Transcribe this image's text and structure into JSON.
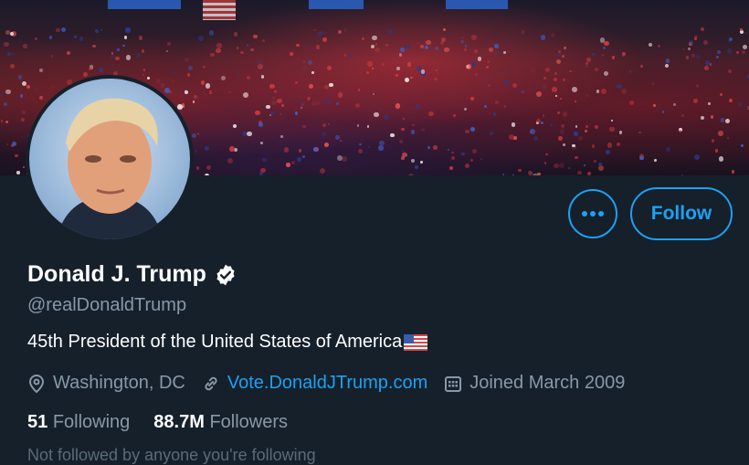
{
  "profile": {
    "display_name": "Donald J. Trump",
    "verified": true,
    "handle": "@realDonaldTrump",
    "bio": "45th President of the United States of America",
    "bio_emoji": "us-flag-icon",
    "location": "Washington, DC",
    "website": "Vote.DonaldJTrump.com",
    "joined": "Joined March 2009"
  },
  "stats": {
    "following_count": "51",
    "following_label": "Following",
    "followers_count": "88.7M",
    "followers_label": "Followers"
  },
  "actions": {
    "more_label": "•••",
    "follow_label": "Follow"
  },
  "footer": {
    "partial_text": "Not followed by anyone you're following"
  },
  "colors": {
    "background": "#15202b",
    "accent": "#1da1f2",
    "secondary_text": "#8899a6",
    "primary_text": "#ffffff"
  }
}
